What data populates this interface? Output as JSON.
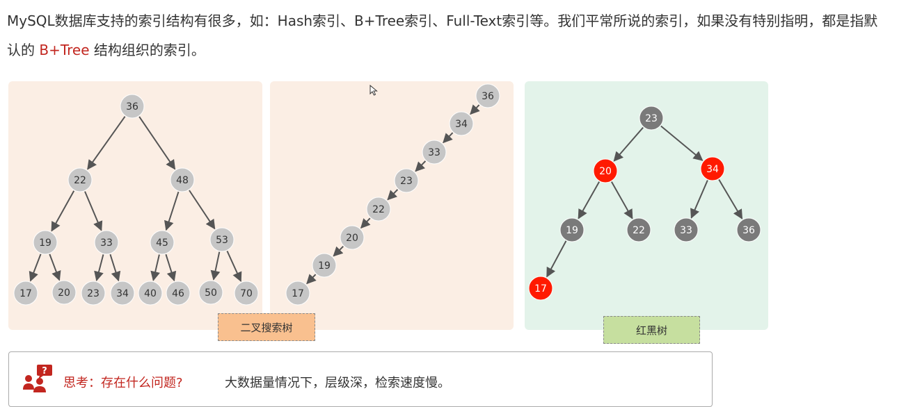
{
  "intro": {
    "before": "MySQL数据库支持的索引结构有很多，如：Hash索引、B+Tree索引、Full-Text索引等。我们平常所说的索引，如果没有特别指明，都是指默认的 ",
    "highlight": "B+Tree",
    "after": " 结构组织的索引。"
  },
  "colors": {
    "bst_panel": "#fbeee4",
    "rb_panel": "#e3f3ea",
    "node_light": "#c6c6c6",
    "node_dark": "#7a7a7a",
    "node_red": "#ff1a00",
    "highlight_text": "#c2261f"
  },
  "trees": {
    "bst": {
      "nodes": [
        {
          "label": "36",
          "parent": null
        },
        {
          "label": "22",
          "parent": "36"
        },
        {
          "label": "48",
          "parent": "36"
        },
        {
          "label": "19",
          "parent": "22"
        },
        {
          "label": "33",
          "parent": "22"
        },
        {
          "label": "45",
          "parent": "48"
        },
        {
          "label": "53",
          "parent": "48"
        },
        {
          "label": "17",
          "parent": "19"
        },
        {
          "label": "20",
          "parent": "19"
        },
        {
          "label": "23",
          "parent": "33"
        },
        {
          "label": "34",
          "parent": "33"
        },
        {
          "label": "40",
          "parent": "45"
        },
        {
          "label": "46",
          "parent": "45"
        },
        {
          "label": "50",
          "parent": "53"
        },
        {
          "label": "70",
          "parent": "53"
        }
      ]
    },
    "degenerate": {
      "nodes": [
        {
          "label": "36",
          "parent": null
        },
        {
          "label": "34",
          "parent": "36"
        },
        {
          "label": "33",
          "parent": "34"
        },
        {
          "label": "23",
          "parent": "33"
        },
        {
          "label": "22",
          "parent": "23"
        },
        {
          "label": "20",
          "parent": "22"
        },
        {
          "label": "19",
          "parent": "20"
        },
        {
          "label": "17",
          "parent": "19"
        }
      ]
    },
    "red_black": {
      "nodes": [
        {
          "label": "23",
          "parent": null,
          "color": "black"
        },
        {
          "label": "20",
          "parent": "23",
          "color": "red"
        },
        {
          "label": "34",
          "parent": "23",
          "color": "red"
        },
        {
          "label": "19",
          "parent": "20",
          "color": "black"
        },
        {
          "label": "22",
          "parent": "20",
          "color": "black"
        },
        {
          "label": "33",
          "parent": "34",
          "color": "black"
        },
        {
          "label": "36",
          "parent": "34",
          "color": "black"
        },
        {
          "label": "17",
          "parent": "19",
          "color": "red"
        }
      ]
    }
  },
  "captions": {
    "bst": "二叉搜索树",
    "rb": "红黑树"
  },
  "think": {
    "question": "思考：存在什么问题?",
    "answer": "大数据量情况下，层级深，检索速度慢。",
    "icon": "people-question-icon"
  }
}
